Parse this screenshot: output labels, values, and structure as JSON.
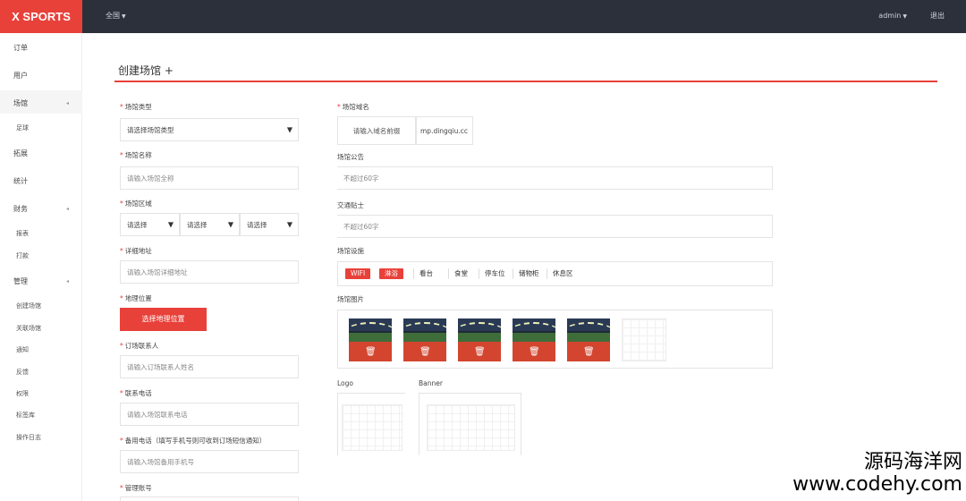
{
  "header": {
    "brand": "X SPORTS",
    "menu_label": "全国",
    "user_label": "admin",
    "logout_label": "退出"
  },
  "sidebar": {
    "items": [
      {
        "label": "订单"
      },
      {
        "label": "用户"
      },
      {
        "label": "场馆"
      },
      {
        "label": "足球"
      },
      {
        "label": "拓展"
      },
      {
        "label": "统计"
      },
      {
        "label": "财务"
      },
      {
        "label": "报表"
      },
      {
        "label": "打款"
      },
      {
        "label": "管理"
      },
      {
        "label": "创建场馆"
      },
      {
        "label": "关联场馆"
      },
      {
        "label": "通知"
      },
      {
        "label": "反馈"
      },
      {
        "label": "权限"
      },
      {
        "label": "标签库"
      },
      {
        "label": "操作日志"
      }
    ]
  },
  "page": {
    "title": "创建场馆 +"
  },
  "form_left": {
    "venue_type": {
      "label": "场馆类型",
      "value": "请选择场馆类型"
    },
    "venue_name": {
      "label": "场馆名称",
      "placeholder": "请输入场馆全称"
    },
    "venue_area": {
      "label": "场馆区域",
      "selects": [
        "请选择",
        "请选择",
        "请选择"
      ]
    },
    "address": {
      "label": "详细地址",
      "placeholder": "请输入场馆详细地址"
    },
    "location": {
      "label": "地理位置",
      "button": "选择地理位置"
    },
    "contact": {
      "label": "订场联系人",
      "placeholder": "请输入订场联系人姓名"
    },
    "phone": {
      "label": "联系电话",
      "placeholder": "请输入场馆联系电话"
    },
    "backup_phone": {
      "label": "备用电话（填写手机号则可收到订场短信通知）",
      "placeholder": "请输入场馆备用手机号"
    },
    "manager_account": {
      "label": "管理账号"
    }
  },
  "form_right": {
    "domain": {
      "label": "场馆域名",
      "prefix_placeholder": "请输入域名前缀",
      "suffix": "mp.dingqiu.cc"
    },
    "notice": {
      "label": "场馆公告",
      "placeholder": "不超过60字"
    },
    "traffic": {
      "label": "交通贴士",
      "placeholder": "不超过60字"
    },
    "facilities": {
      "label": "场馆设施",
      "items": [
        {
          "label": "WIFI",
          "active": true
        },
        {
          "label": "淋浴",
          "active": true
        },
        {
          "label": "看台",
          "active": false
        },
        {
          "label": "食堂",
          "active": false
        },
        {
          "label": "停车位",
          "active": false
        },
        {
          "label": "储物柜",
          "active": false
        },
        {
          "label": "休息区",
          "active": false
        }
      ]
    },
    "photos": {
      "label": "场馆图片",
      "count": 5,
      "delete_icon": "trash-icon"
    },
    "logo": {
      "label": "Logo"
    },
    "banner": {
      "label": "Banner"
    }
  },
  "watermark": {
    "line1": "源码海洋网",
    "line2": "www.codehy.com"
  },
  "colors": {
    "accent": "#e8413a",
    "topbar": "#2b303b"
  }
}
